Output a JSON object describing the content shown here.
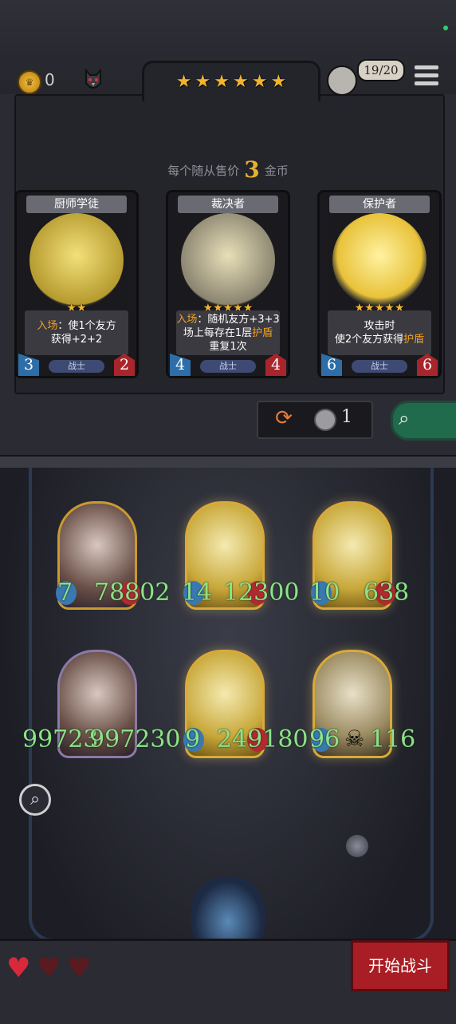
{
  "top": {
    "gold": "0",
    "tavern_stars": 6,
    "lives_badge": "19/20"
  },
  "shop": {
    "sell_prefix": "每个随从售价",
    "sell_price": "3",
    "sell_suffix": "金币",
    "cards": [
      {
        "name": "厨师学徒",
        "stars": 2,
        "desc_l1_hl": "入场",
        "desc_l1": "：使1个友方",
        "desc_l2": "获得+2+2",
        "desc_l3": "",
        "tribe": "战士",
        "attack": "3",
        "health": "2"
      },
      {
        "name": "裁决者",
        "stars": 5,
        "desc_l1_hl": "入场",
        "desc_l1": "：随机友方+3+3",
        "desc_l2": "场上每存在1层",
        "desc_l2_hl": "护盾",
        "desc_l3": "重复1次",
        "tribe": "战士",
        "attack": "4",
        "health": "4"
      },
      {
        "name": "保护者",
        "stars": 5,
        "desc_l1_hl": "",
        "desc_l1": "攻击时",
        "desc_l2": "使2个友方获得",
        "desc_l2_hl": "护盾",
        "desc_l3": "",
        "tribe": "战士",
        "attack": "6",
        "health": "6"
      }
    ],
    "refresh_cost": "1"
  },
  "board": {
    "units": [
      {
        "attack": "7",
        "health": "78802"
      },
      {
        "attack": "14",
        "health": "12300"
      },
      {
        "attack": "10",
        "health": "638"
      },
      {
        "attack": "99723",
        "health": "997230"
      },
      {
        "attack": "9",
        "health": "249180"
      },
      {
        "attack": "96",
        "health": "116"
      }
    ]
  },
  "bottom": {
    "hearts_filled": 1,
    "hearts_total": 3,
    "start_label": "开始战斗"
  },
  "colors": {
    "gold": "#f1b431",
    "stat_green": "#8fe08a",
    "start_red": "#a81e24"
  }
}
